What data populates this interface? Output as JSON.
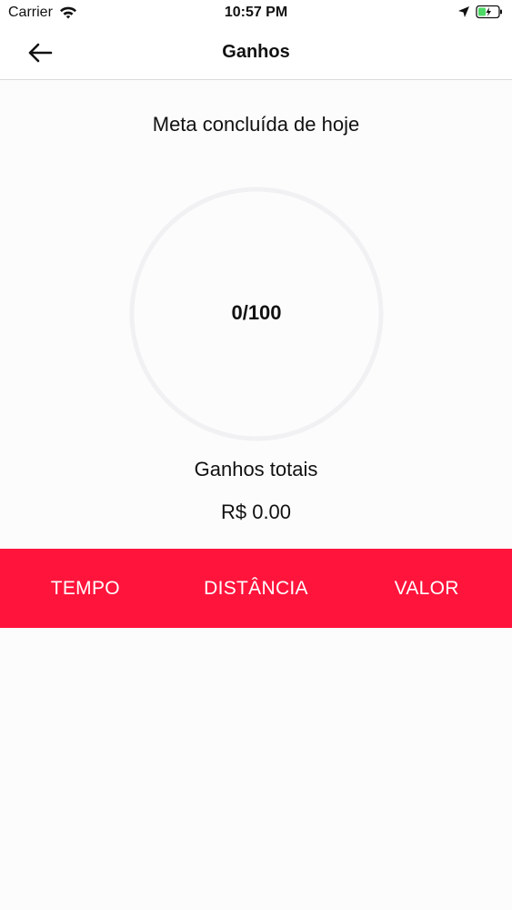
{
  "status_bar": {
    "carrier": "Carrier",
    "time": "10:57 PM",
    "icons": [
      "wifi-icon",
      "location-icon",
      "battery-icon"
    ],
    "battery_color": "#4cd964"
  },
  "nav": {
    "title": "Ganhos",
    "back_icon": "back-arrow-icon"
  },
  "goal": {
    "label": "Meta concluída de hoje",
    "progress_text": "0/100",
    "progress_fraction": 0
  },
  "earnings": {
    "label": "Ganhos totais",
    "value": "R$ 0.00"
  },
  "tabs": [
    {
      "label": "TEMPO"
    },
    {
      "label": "DISTÂNCIA"
    },
    {
      "label": "VALOR"
    }
  ],
  "colors": {
    "accent": "#ff143c",
    "ring_track": "#f1f1f3"
  }
}
